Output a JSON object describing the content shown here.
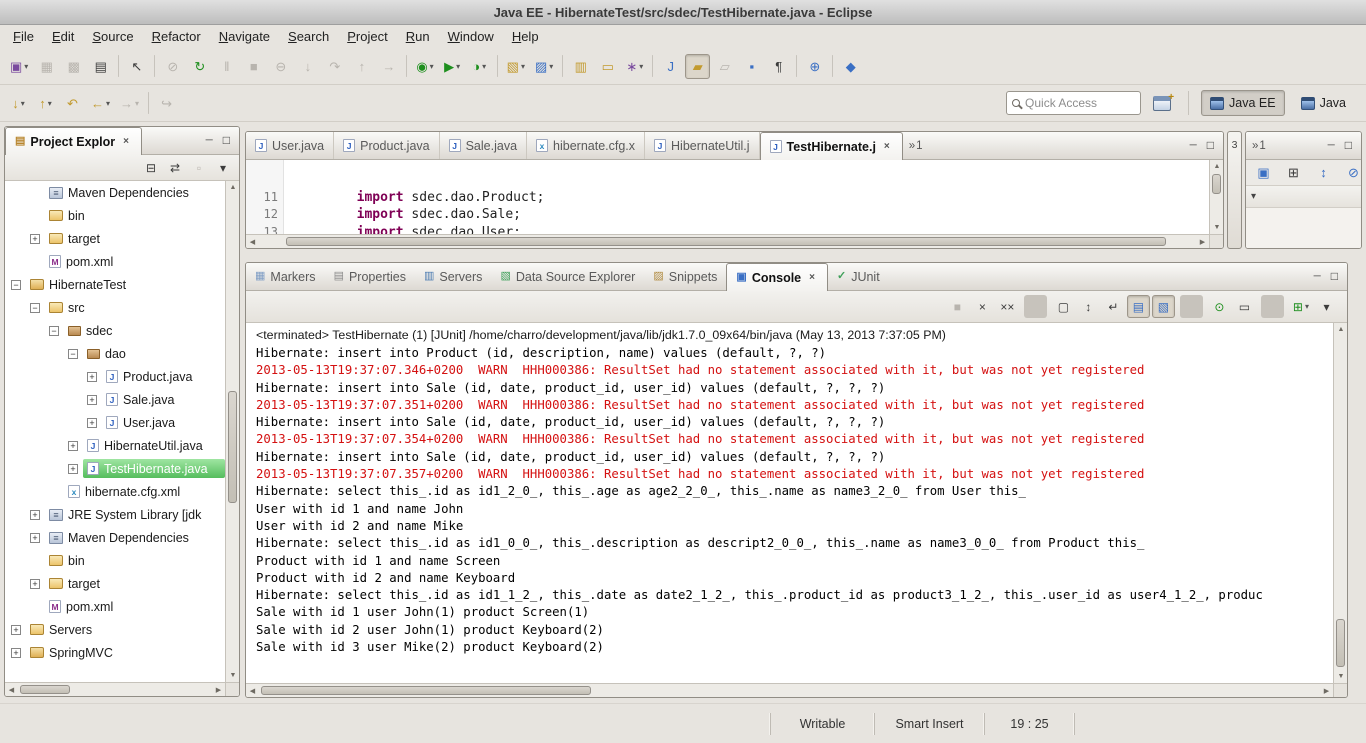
{
  "window": {
    "title": "Java EE - HibernateTest/src/sdec/TestHibernate.java - Eclipse"
  },
  "menubar": {
    "items": [
      "File",
      "Edit",
      "Source",
      "Refactor",
      "Navigate",
      "Search",
      "Project",
      "Run",
      "Window",
      "Help"
    ]
  },
  "toolbar_main": {
    "buttons": [
      {
        "name": "new-wizard",
        "glyph": "▣",
        "color": "violet",
        "dropdown": true
      },
      {
        "name": "save",
        "glyph": "▦",
        "disabled": true
      },
      {
        "name": "save-all",
        "glyph": "▩",
        "disabled": true
      },
      {
        "name": "print",
        "glyph": "▤",
        "color": "dark"
      },
      {
        "sep": true
      },
      {
        "name": "select-pointer",
        "glyph": "↖",
        "color": "dark"
      },
      {
        "sep": true
      },
      {
        "name": "skip-breakpoints",
        "glyph": "⊘",
        "disabled": true
      },
      {
        "name": "restart",
        "glyph": "↻",
        "color": "green"
      },
      {
        "name": "suspend",
        "glyph": "‖",
        "disabled": true
      },
      {
        "name": "terminate",
        "glyph": "■",
        "disabled": true
      },
      {
        "name": "disconnect",
        "glyph": "⊖",
        "disabled": true
      },
      {
        "name": "step-into",
        "glyph": "↓",
        "disabled": true
      },
      {
        "name": "step-over",
        "glyph": "↷",
        "disabled": true
      },
      {
        "name": "step-return",
        "glyph": "↑",
        "disabled": true
      },
      {
        "name": "drop-to-frame",
        "glyph": "→",
        "disabled": true
      },
      {
        "sep": true
      },
      {
        "name": "debug",
        "glyph": "◉",
        "color": "green",
        "dropdown": true
      },
      {
        "name": "run",
        "glyph": "▶",
        "color": "green",
        "dropdown": true
      },
      {
        "name": "coverage",
        "glyph": "◑",
        "color": "green",
        "dropdown": true
      },
      {
        "sep": true
      },
      {
        "name": "new-java-project",
        "glyph": "▧",
        "color": "gold",
        "dropdown": true
      },
      {
        "name": "new-web-component",
        "glyph": "▨",
        "color": "blue",
        "dropdown": true
      },
      {
        "sep": true
      },
      {
        "name": "package-jar",
        "glyph": "▥",
        "color": "gold"
      },
      {
        "name": "deploy-folder",
        "glyph": "▭",
        "color": "gold"
      },
      {
        "name": "wizard",
        "glyph": "∗",
        "color": "violet",
        "dropdown": true
      },
      {
        "sep": true
      },
      {
        "name": "java-editor",
        "glyph": "J",
        "color": "blue"
      },
      {
        "name": "mark-occurrences",
        "glyph": "▰",
        "color": "gold",
        "pressed": true
      },
      {
        "name": "next-change",
        "glyph": "▱",
        "disabled": true
      },
      {
        "name": "open-type",
        "glyph": "▪",
        "color": "blue"
      },
      {
        "name": "show-whitespace",
        "glyph": "¶",
        "color": "dark"
      },
      {
        "sep": true
      },
      {
        "name": "web-browser",
        "glyph": "⊕",
        "color": "blue"
      },
      {
        "sep": true
      },
      {
        "name": "search",
        "glyph": "◆",
        "color": "blue"
      }
    ]
  },
  "toolbar_nav": {
    "buttons": [
      {
        "name": "next-annotation",
        "glyph": "↓",
        "color": "gold",
        "dropdown": true
      },
      {
        "name": "previous-annotation",
        "glyph": "↑",
        "color": "gold",
        "dropdown": true
      },
      {
        "name": "last-edit-location",
        "glyph": "↶",
        "color": "gold"
      },
      {
        "name": "back",
        "glyph": "←",
        "color": "gold",
        "dropdown": true
      },
      {
        "name": "forward",
        "glyph": "→",
        "disabled": true,
        "dropdown": true
      },
      {
        "sep": true
      },
      {
        "name": "go-into",
        "glyph": "↪",
        "disabled": true
      }
    ],
    "quick_access_placeholder": "Quick Access",
    "perspective_buttons": [
      {
        "label": "Java EE",
        "active": true
      },
      {
        "label": "Java"
      }
    ]
  },
  "explorer": {
    "title": "Project Explor",
    "toolbar": [
      {
        "name": "collapse-all",
        "glyph": "⊟",
        "color": "dark"
      },
      {
        "name": "link-with-editor",
        "glyph": "⇄",
        "color": "dark"
      },
      {
        "name": "focus-view",
        "glyph": "▫",
        "disabled": true
      },
      {
        "name": "view-menu",
        "glyph": "▾",
        "color": "dark"
      }
    ],
    "tree": [
      {
        "label": "Maven Dependencies",
        "level": 1,
        "ic": "library",
        "expand": ""
      },
      {
        "label": "bin",
        "level": 1,
        "ic": "folder",
        "expand": ""
      },
      {
        "label": "target",
        "level": 1,
        "ic": "folder",
        "expand": "+"
      },
      {
        "label": "pom.xml",
        "level": 1,
        "ic": "maven",
        "expand": ""
      },
      {
        "label": "HibernateTest",
        "level": 0,
        "ic": "project",
        "expand": "−"
      },
      {
        "label": "src",
        "level": 1,
        "ic": "src",
        "expand": "−"
      },
      {
        "label": "sdec",
        "level": 2,
        "ic": "package",
        "expand": "−"
      },
      {
        "label": "dao",
        "level": 3,
        "ic": "package",
        "expand": "−"
      },
      {
        "label": "Product.java",
        "level": 4,
        "ic": "java",
        "expand": "+"
      },
      {
        "label": "Sale.java",
        "level": 4,
        "ic": "java",
        "expand": "+"
      },
      {
        "label": "User.java",
        "level": 4,
        "ic": "java",
        "expand": "+"
      },
      {
        "label": "HibernateUtil.java",
        "level": 3,
        "ic": "java",
        "expand": "+"
      },
      {
        "label": "TestHibernate.java",
        "level": 3,
        "ic": "java",
        "expand": "+",
        "selected": true
      },
      {
        "label": "hibernate.cfg.xml",
        "level": 2,
        "ic": "xml",
        "expand": ""
      },
      {
        "label": "JRE System Library [jdk",
        "level": 1,
        "ic": "library",
        "expand": "+"
      },
      {
        "label": "Maven Dependencies",
        "level": 1,
        "ic": "library",
        "expand": "+"
      },
      {
        "label": "bin",
        "level": 1,
        "ic": "folder",
        "expand": ""
      },
      {
        "label": "target",
        "level": 1,
        "ic": "folder",
        "expand": "+"
      },
      {
        "label": "pom.xml",
        "level": 1,
        "ic": "maven",
        "expand": ""
      },
      {
        "label": "Servers",
        "level": 0,
        "ic": "folder",
        "expand": "+"
      },
      {
        "label": "SpringMVC",
        "level": 0,
        "ic": "project",
        "expand": "+"
      }
    ]
  },
  "editor": {
    "tabs": [
      {
        "label": "User.java",
        "ic": "java"
      },
      {
        "label": "Product.java",
        "ic": "java"
      },
      {
        "label": "Sale.java",
        "ic": "java"
      },
      {
        "label": "hibernate.cfg.x",
        "ic": "xml"
      },
      {
        "label": "HibernateUtil.j",
        "ic": "java"
      },
      {
        "label": "TestHibernate.j",
        "ic": "java",
        "active": true
      }
    ],
    "overflow_count": "1",
    "code": [
      {
        "num": "11",
        "kw": "import",
        "rest": " sdec.dao.Product;"
      },
      {
        "num": "12",
        "kw": "import",
        "rest": " sdec.dao.Sale;"
      },
      {
        "num": "13",
        "kw": "import",
        "rest": " sdec.dao.User;"
      }
    ]
  },
  "right_strip": {
    "count": "3"
  },
  "right_panel": {
    "overflow_count": "1",
    "icons": [
      {
        "name": "focus",
        "glyph": "▣",
        "color": "blue"
      },
      {
        "name": "collapse",
        "glyph": "⊞",
        "color": "dark"
      },
      {
        "name": "sort",
        "glyph": "↕",
        "color": "blue"
      },
      {
        "name": "filter",
        "glyph": "⊘",
        "color": "blue"
      }
    ]
  },
  "console": {
    "tabs": [
      {
        "label": "Markers",
        "ic": "markers"
      },
      {
        "label": "Properties",
        "ic": "props"
      },
      {
        "label": "Servers",
        "ic": "servers"
      },
      {
        "label": "Data Source Explorer",
        "ic": "dse"
      },
      {
        "label": "Snippets",
        "ic": "snippets"
      },
      {
        "label": "Console",
        "ic": "console",
        "active": true
      },
      {
        "label": "JUnit",
        "ic": "junit"
      }
    ],
    "toolbar": [
      {
        "name": "terminate",
        "glyph": "■",
        "disabled": true
      },
      {
        "name": "remove-launch",
        "glyph": "×",
        "color": "dark"
      },
      {
        "name": "remove-all-launches",
        "glyph": "××",
        "color": "dark"
      },
      {
        "sep": true
      },
      {
        "name": "clear-console",
        "glyph": "▢",
        "color": "dark"
      },
      {
        "name": "scroll-lock",
        "glyph": "↕",
        "color": "dark"
      },
      {
        "name": "word-wrap",
        "glyph": "↵",
        "color": "dark"
      },
      {
        "name": "show-on-stdout",
        "glyph": "▤",
        "color": "blue",
        "pressed": true
      },
      {
        "name": "show-on-stderr",
        "glyph": "▧",
        "color": "blue",
        "pressed": true
      },
      {
        "sep": true
      },
      {
        "name": "pin-console",
        "glyph": "⊙",
        "color": "green"
      },
      {
        "name": "display-selected-console",
        "glyph": "▭",
        "color": "dark"
      },
      {
        "sep": true
      },
      {
        "name": "open-console",
        "glyph": "⊞",
        "color": "green",
        "dropdown": true
      },
      {
        "name": "console-view-menu",
        "glyph": "▾",
        "color": "dark"
      }
    ],
    "header": "<terminated> TestHibernate (1) [JUnit] /home/charro/development/java/lib/jdk1.7.0_09x64/bin/java (May 13, 2013 7:37:05 PM)",
    "lines": [
      {
        "text": "Hibernate: insert into Product (id, description, name) values (default, ?, ?)"
      },
      {
        "text": "2013-05-13T19:37:07.346+0200  WARN  HHH000386: ResultSet had no statement associated with it, but was not yet registered",
        "warn": true
      },
      {
        "text": "Hibernate: insert into Sale (id, date, product_id, user_id) values (default, ?, ?, ?)"
      },
      {
        "text": "2013-05-13T19:37:07.351+0200  WARN  HHH000386: ResultSet had no statement associated with it, but was not yet registered",
        "warn": true
      },
      {
        "text": "Hibernate: insert into Sale (id, date, product_id, user_id) values (default, ?, ?, ?)"
      },
      {
        "text": "2013-05-13T19:37:07.354+0200  WARN  HHH000386: ResultSet had no statement associated with it, but was not yet registered",
        "warn": true
      },
      {
        "text": "Hibernate: insert into Sale (id, date, product_id, user_id) values (default, ?, ?, ?)"
      },
      {
        "text": "2013-05-13T19:37:07.357+0200  WARN  HHH000386: ResultSet had no statement associated with it, but was not yet registered",
        "warn": true
      },
      {
        "text": "Hibernate: select this_.id as id1_2_0_, this_.age as age2_2_0_, this_.name as name3_2_0_ from User this_"
      },
      {
        "text": "User with id 1 and name John"
      },
      {
        "text": "User with id 2 and name Mike"
      },
      {
        "text": "Hibernate: select this_.id as id1_0_0_, this_.description as descript2_0_0_, this_.name as name3_0_0_ from Product this_"
      },
      {
        "text": "Product with id 1 and name Screen"
      },
      {
        "text": "Product with id 2 and name Keyboard"
      },
      {
        "text": "Hibernate: select this_.id as id1_1_2_, this_.date as date2_1_2_, this_.product_id as product3_1_2_, this_.user_id as user4_1_2_, produc"
      },
      {
        "text": "Sale with id 1 user John(1) product Screen(1)"
      },
      {
        "text": "Sale with id 2 user John(1) product Keyboard(2)"
      },
      {
        "text": "Sale with id 3 user Mike(2) product Keyboard(2)"
      }
    ]
  },
  "statusbar": {
    "writable": "Writable",
    "insert_mode": "Smart Insert",
    "caret_position": "19 : 25"
  }
}
